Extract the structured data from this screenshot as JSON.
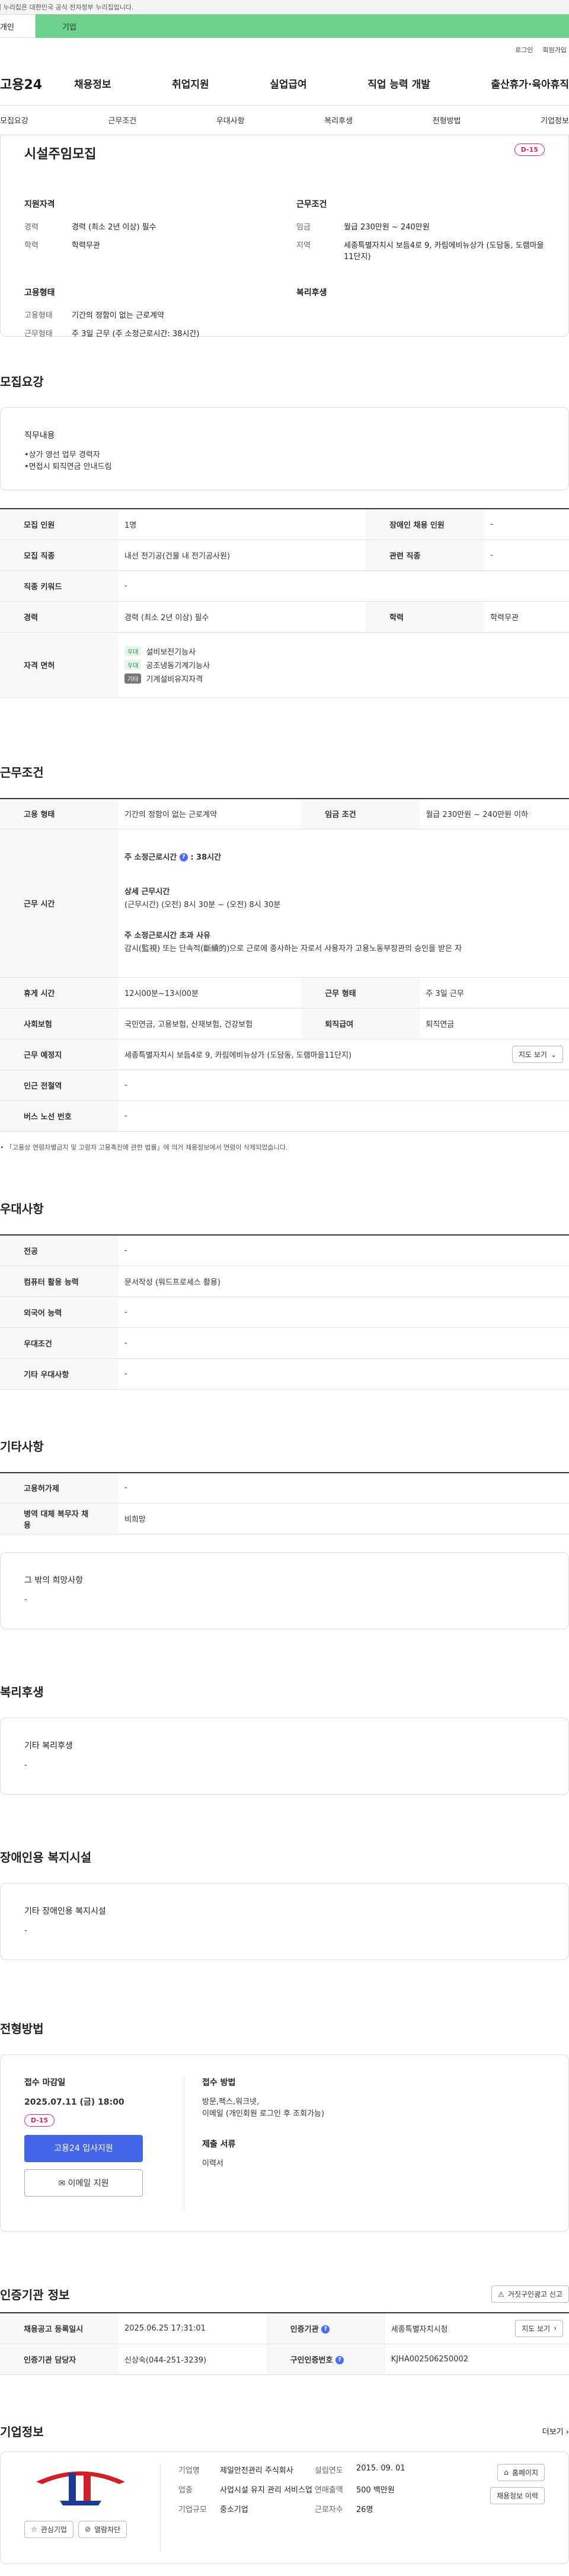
{
  "gov_bar": {
    "text": "이 누리집은 대한민국 공식 전자정부 누리집입니다."
  },
  "top_tabs": {
    "personal": "개인",
    "company": "기업"
  },
  "util": {
    "login": "로그인",
    "signup": "회원가입"
  },
  "gnb": {
    "logo": "고용24",
    "menu": [
      "채용정보",
      "취업지원",
      "실업급여",
      "직업 능력 개발",
      "출산휴가·육아휴직"
    ]
  },
  "anchors": [
    "모집요강",
    "근무조건",
    "우대사항",
    "복리후생",
    "전형방법",
    "기업정보"
  ],
  "summary": {
    "title": "시설주임모집",
    "dday": "D-15",
    "qualification": {
      "heading": "지원자격",
      "rows": [
        {
          "k": "경력",
          "v": "경력 (최소 2년 이상) 필수"
        },
        {
          "k": "학력",
          "v": "학력무관"
        }
      ]
    },
    "condition": {
      "heading": "근무조건",
      "rows": [
        {
          "k": "임금",
          "v": "월급 230만원 ~ 240만원"
        },
        {
          "k": "지역",
          "v": "세종특별자치시 보듬4로 9, 카림에비뉴상가 (도담동, 도램마을11단지)"
        }
      ]
    },
    "employment": {
      "heading": "고용형태",
      "rows": [
        {
          "k": "고용형태",
          "v": "기간의 정함이 없는 근로계약"
        },
        {
          "k": "근무형태",
          "v": "주 3일 근무 (주 소정근로시간: 38시간)"
        }
      ]
    },
    "welfare": {
      "heading": "복리후생"
    }
  },
  "recruit": {
    "heading": "모집요강",
    "duty_heading": "직무내용",
    "duty_lines": [
      "•상가 영선 업무 경력자",
      "•면접시 퇴직연금 안내드림"
    ],
    "rows": [
      {
        "k1": "모집 인원",
        "v1": "1명",
        "k2": "장애인 채용 인원",
        "v2": "-"
      },
      {
        "k1": "모집 직종",
        "v1": "내선 전기공(건물 내 전기공사원)",
        "k2": "관련 직종",
        "v2": "-"
      },
      {
        "k1": "직종 키워드",
        "v1": "-"
      },
      {
        "k1": "경력",
        "v1": "경력 (최소 2년 이상) 필수",
        "k2": "학력",
        "v2": "학력무관"
      }
    ],
    "license_label": "자격 면허",
    "licenses": [
      {
        "tag": "우대",
        "name": "설비보전기능사"
      },
      {
        "tag": "우대",
        "name": "공조냉동기계기능사"
      },
      {
        "tag": "기타",
        "name": "기계설비유지자격"
      }
    ]
  },
  "work": {
    "heading": "근무조건",
    "type_label": "고용 형태",
    "type_value": "기간의 정함이 없는 근로계약",
    "pay_label": "임금 조건",
    "pay_value": "월급 230만원 ~ 240만원 이하",
    "hours_label": "근무 시간",
    "hours_weekly_label": "주 소정근로시간",
    "hours_weekly_value": ": 38시간",
    "hours_detail_label": "상세 근무시간",
    "hours_detail_value": "(근무시간) (오전) 8시 30분 ~ (오전) 8시 30분",
    "hours_over_label": "주 소정근로시간 초과 사유",
    "hours_over_value": "감시(監視) 또는 단속적(斷續的)으로 근로에 종사하는 자로서 사용자가 고용노동부장관의 승인을 받은 자",
    "break_label": "휴게 시간",
    "break_value": "12시00분~13시00분",
    "form_label": "근무 형태",
    "form_value": "주 3일 근무",
    "insurance_label": "사회보험",
    "insurance_value": "국민연금, 고용보험, 산재보험, 건강보험",
    "severance_label": "퇴직급여",
    "severance_value": "퇴직연금",
    "place_label": "근무 예정지",
    "place_value": "세종특별자치시 보듬4로 9, 카림에비뉴상가 (도담동, 도램마을11단지)",
    "map_button": "지도 보기",
    "subway_label": "인근 전철역",
    "subway_value": "-",
    "bus_label": "버스 노선 번호",
    "bus_value": "-",
    "notice": "「고용상 연령차별금지 및 고령자 고용촉진에 관한 법률」에 의거 채용정보에서 연령이 삭제되었습니다."
  },
  "pref": {
    "heading": "우대사항",
    "rows": [
      {
        "k": "전공",
        "v": "-"
      },
      {
        "k": "컴퓨터 활용 능력",
        "v": "문서작성 (워드프로세스 활용)"
      },
      {
        "k": "외국어 능력",
        "v": "-"
      },
      {
        "k": "우대조건",
        "v": "-"
      },
      {
        "k": "기타 우대사항",
        "v": "-"
      }
    ]
  },
  "etc": {
    "heading": "기타사항",
    "rows": [
      {
        "k": "고용허가제",
        "v": "-"
      },
      {
        "k": "병역 대체 복무자 채용",
        "v": "비희망"
      }
    ],
    "box_heading": "그 밖의 희망사항",
    "box_value": "-"
  },
  "benefit": {
    "heading": "복리후생",
    "box_heading": "기타 복리후생",
    "box_value": "-"
  },
  "disabled": {
    "heading": "장애인용 복지시설",
    "box_heading": "기타 장애인용 복지시설",
    "box_value": "-"
  },
  "process": {
    "heading": "전형방법",
    "deadline_label": "접수 마감일",
    "deadline_value": "2025.07.11 (금) 18:00",
    "dday": "D-15",
    "apply_button": "고용24 입사지원",
    "email_button": "이메일 지원",
    "method_label": "접수 방법",
    "method_value": "방문,팩스,워크넷,\n이메일 (개인회원 로그인 후 조회가능)",
    "docs_label": "제출 서류",
    "docs_value": "이력서"
  },
  "cert": {
    "heading": "인증기관 정보",
    "report_button": "거짓구인광고 신고",
    "reg_label": "채용공고 등록일시",
    "reg_value": "2025.06.25 17:31:01",
    "org_label": "인증기관",
    "org_value": "세종특별자치시청",
    "map_button": "지도 보기",
    "manager_label": "인증기관 담당자",
    "manager_value": "신상숙(044-251-3239)",
    "no_label": "구인인증번호",
    "no_value": "KJHA002506250002"
  },
  "company": {
    "heading": "기업정보",
    "more": "더보기",
    "fav_button": "관심기업",
    "block_button": "열람차단",
    "name_label": "기업명",
    "name_value": "제일안전관리 주식회사",
    "est_label": "설립연도",
    "est_value": "2015. 09. 01",
    "biz_label": "업종",
    "biz_value": "사업시설 유지 관리 서비스업",
    "sales_label": "연매출액",
    "sales_value": "500 백만원",
    "emp_label": "근로자수",
    "emp_value": "26명",
    "size_label": "기업규모",
    "size_value": "중소기업",
    "home_button": "홈페이지",
    "jobs_button": "채용정보 이력",
    "colors": {
      "logo_red": "#d0202a",
      "logo_blue": "#1f3a93"
    }
  }
}
